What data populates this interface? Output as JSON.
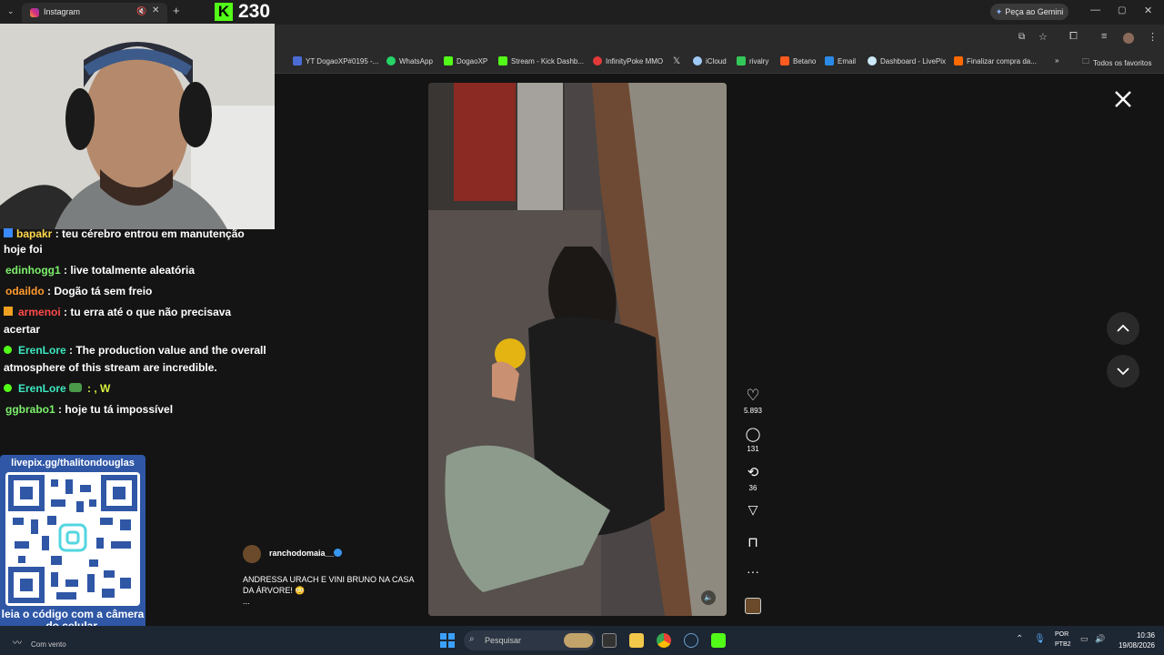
{
  "browser": {
    "tab_title": "Instagram",
    "gemini_button": "Peça ao Gemini",
    "bookmarks": [
      "YT DogaoXP#0195 -...",
      "WhatsApp",
      "DogaoXP",
      "Stream - Kick Dashb...",
      "InfinityPoke MMO",
      "iCloud",
      "rivalry",
      "Betano",
      "Email",
      "Dashboard - LivePix",
      "Finalizar compra da..."
    ],
    "all_favorites": "Todos os favoritos"
  },
  "stream_overlay": {
    "viewer_count": "230",
    "kick_logo": "K",
    "chat": [
      {
        "user": "bapakr",
        "user_color": "#ffd84a",
        "text": " : teu cérebro entrou em manutenção hoje foi"
      },
      {
        "user": "edinhogg1",
        "user_color": "#7cf06b",
        "text": " : live totalmente aleatória"
      },
      {
        "user": "odaildo",
        "user_color": "#ff9b2e",
        "text": " : Dogão tá sem freio"
      },
      {
        "user": "armenoi",
        "user_color": "#ff4a4a",
        "text": " : tu erra até o que não precisava acertar"
      },
      {
        "user": "ErenLore",
        "user_color": "#3de8c0",
        "text": " : The production value and the overall atmosphere of this stream are incredible."
      },
      {
        "user": "ErenLore",
        "user_color": "#3de8c0",
        "text": " : , W"
      },
      {
        "user": "ggbrabo1",
        "user_color": "#7cf06b",
        "text": " : hoje tu tá impossível"
      }
    ],
    "qr_url": "livepix.gg/thalitondouglas",
    "qr_caption": "leia o código com a câmera do celular."
  },
  "reel": {
    "likes": "5.893",
    "comments": "131",
    "reposts": "36",
    "author": "ranchodomaia__",
    "caption": "ANDRESSA URACH E VINI BRUNO NA CASA DA ÁRVORE! 😳",
    "caption_more": "..."
  },
  "taskbar": {
    "weather": "Com vento",
    "search_placeholder": "Pesquisar",
    "lang1": "POR",
    "lang2": "PTB2",
    "time": "10:36",
    "date": "19/08/2026"
  },
  "colors": {
    "kick_green": "#53fc18",
    "livepix_blue": "#2f57a6"
  }
}
